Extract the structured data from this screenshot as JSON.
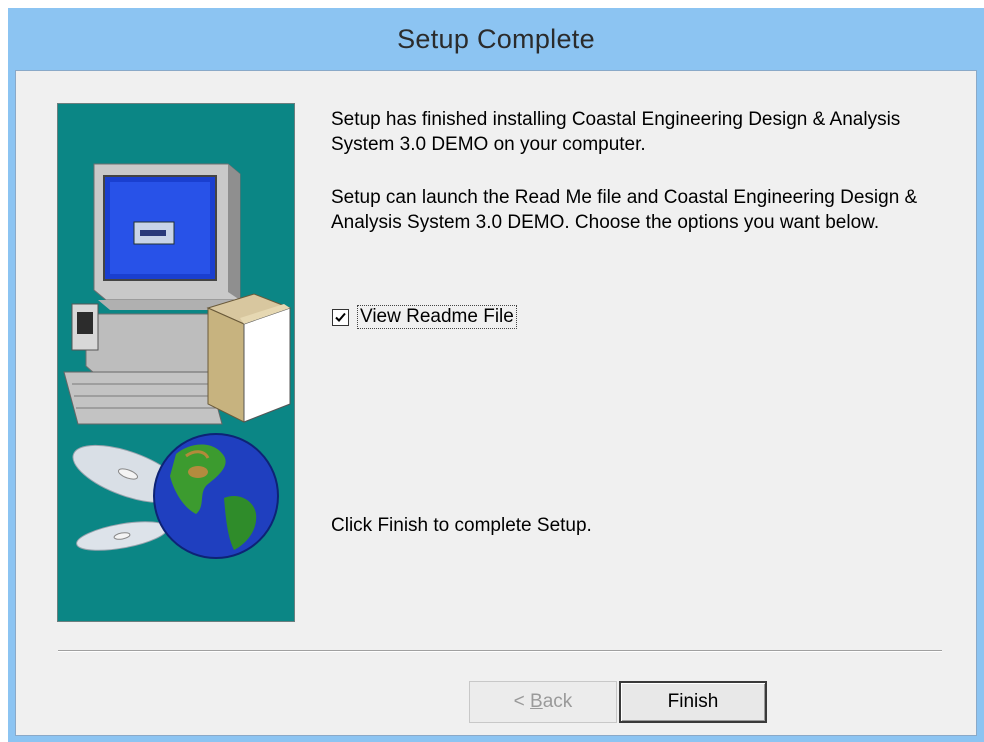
{
  "window": {
    "title": "Setup Complete"
  },
  "content": {
    "line1": "Setup has finished installing Coastal Engineering Design & Analysis System 3.0 DEMO on your computer.",
    "line2": "Setup can launch the Read Me file and Coastal Engineering Design & Analysis System 3.0 DEMO.  Choose the options you want below.",
    "line3": "Click Finish to complete Setup."
  },
  "options": {
    "view_readme": {
      "label": "View Readme File",
      "checked": true
    }
  },
  "buttons": {
    "back_mnemonic": "B",
    "back_rest": "ack",
    "back_prefix": "< ",
    "finish": "Finish"
  },
  "colors": {
    "titlebar": "#8cc4f2",
    "dialog_bg": "#f0f0f0",
    "art_bg": "#0b8685"
  },
  "icons": [
    "computer-icon",
    "cd-disc-icon",
    "globe-icon",
    "checkmark-icon"
  ]
}
